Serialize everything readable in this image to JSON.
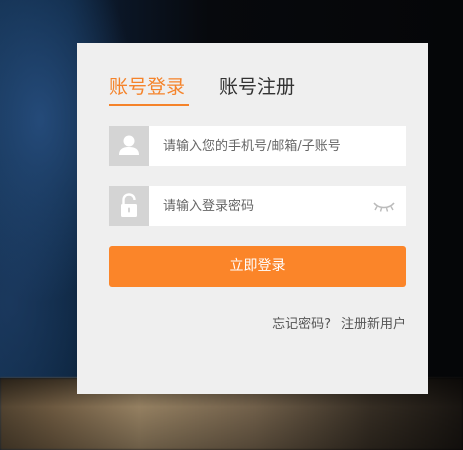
{
  "tabs": {
    "login_label": "账号登录",
    "register_label": "账号注册"
  },
  "form": {
    "username_placeholder": "请输入您的手机号/邮箱/子账号",
    "password_placeholder": "请输入登录密码",
    "submit_label": "立即登录"
  },
  "links": {
    "forgot_password": "忘记密码?",
    "register_new_user": "注册新用户"
  },
  "icons": {
    "username": "user-icon",
    "password": "lock-icon",
    "toggle_password": "eye-closed-icon"
  },
  "colors": {
    "accent": "#fb8529",
    "active_tab": "#f5832a",
    "card_bg": "#efefef",
    "icon_box": "#d4d4d4"
  }
}
